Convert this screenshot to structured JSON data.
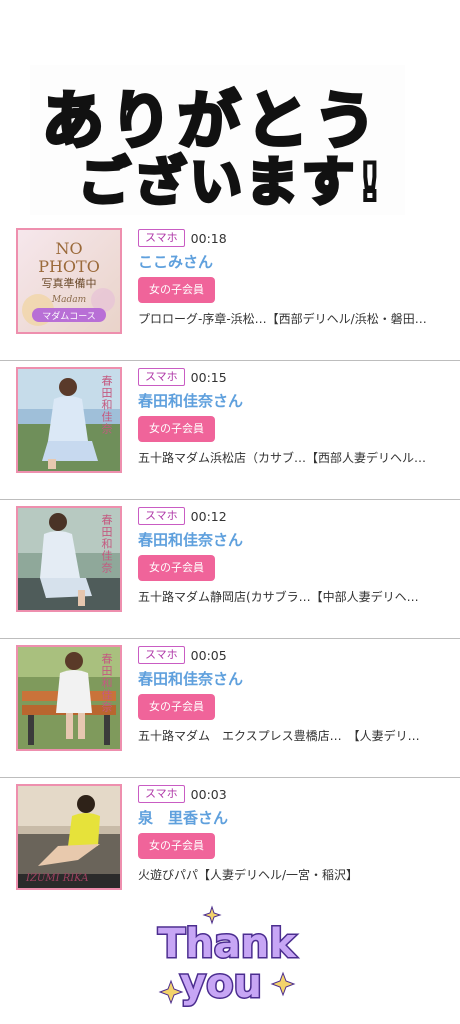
{
  "header": {
    "message_line1": "ありがとう",
    "message_line2": "ございます!"
  },
  "colors": {
    "device_badge": "#c95cc3",
    "member_badge": "#f0649a",
    "name_text": "#5fa0dd",
    "thumb_border": "#ee8fae"
  },
  "entries": [
    {
      "device": "スマホ",
      "time": "00:18",
      "name": "ここみさん",
      "member": "女の子会員",
      "shop": "プロローグ-序章-浜松…【西部デリヘル/浜松・磐田…",
      "thumb": {
        "type": "no-photo",
        "line1": "NO",
        "line2": "PHOTO",
        "line3": "写真準備中",
        "line4": "Madam",
        "line5": "マダムコース"
      }
    },
    {
      "device": "スマホ",
      "time": "00:15",
      "name": "春田和佳奈さん",
      "member": "女の子会員",
      "shop": "五十路マダム浜松店（カサブ…【西部人妻デリヘル…",
      "thumb": {
        "type": "photo",
        "caption": "春田和佳奈"
      }
    },
    {
      "device": "スマホ",
      "time": "00:12",
      "name": "春田和佳奈さん",
      "member": "女の子会員",
      "shop": "五十路マダム静岡店(カサブラ…【中部人妻デリヘ…",
      "thumb": {
        "type": "photo",
        "caption": "春田和佳奈"
      }
    },
    {
      "device": "スマホ",
      "time": "00:05",
      "name": "春田和佳奈さん",
      "member": "女の子会員",
      "shop": "五十路マダム　エクスプレス豊橋店…　【人妻デリ…",
      "thumb": {
        "type": "photo",
        "caption": "春田和佳奈"
      }
    },
    {
      "device": "スマホ",
      "time": "00:03",
      "name": "泉　里香さん",
      "member": "女の子会員",
      "shop": "火遊びパパ【人妻デリヘル/一宮・稲沢】",
      "thumb": {
        "type": "photo",
        "caption": "IZUMI RIKA"
      }
    }
  ],
  "footer": {
    "line1": "Thank",
    "line2": "you"
  }
}
